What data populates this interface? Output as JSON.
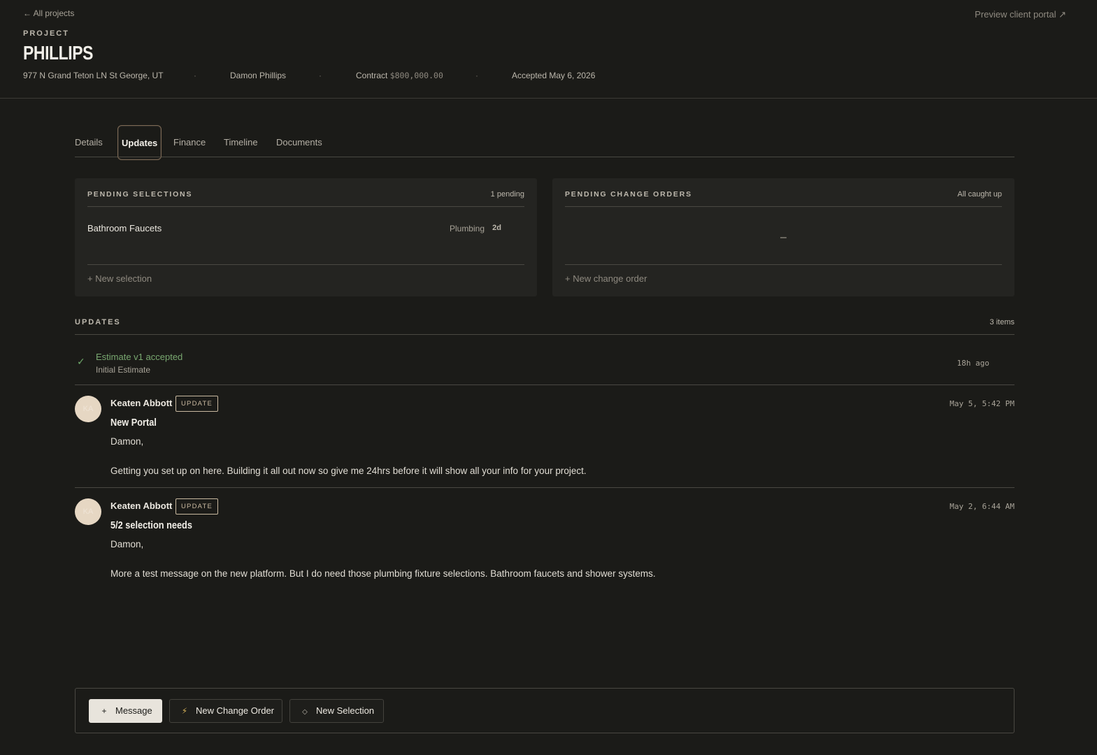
{
  "header": {
    "back_link": "← All projects",
    "preview_link": "Preview client portal ↗",
    "eyebrow": "PROJECT",
    "title": "PHILLIPS",
    "address": "977 N Grand Teton LN St George, UT",
    "client": "Damon Phillips",
    "contract_label": "Contract",
    "contract_value": "$800,000.00",
    "accepted": "Accepted May 6, 2026",
    "separator": "·"
  },
  "tabs": [
    {
      "label": "Details",
      "active": false
    },
    {
      "label": "Updates",
      "active": true
    },
    {
      "label": "Finance",
      "active": false
    },
    {
      "label": "Timeline",
      "active": false
    },
    {
      "label": "Documents",
      "active": false
    }
  ],
  "pending_selections": {
    "label": "PENDING SELECTIONS",
    "status": "1 pending",
    "items": [
      {
        "name": "Bathroom Faucets",
        "category": "Plumbing",
        "age": "2d"
      }
    ],
    "add_label": "+ New selection"
  },
  "pending_change_orders": {
    "label": "PENDING CHANGE ORDERS",
    "status": "All caught up",
    "empty": "–",
    "add_label": "+ New change order"
  },
  "updates": {
    "label": "UPDATES",
    "count": "3 items",
    "event": {
      "icon": "check-icon",
      "title": "Estimate v1 accepted",
      "subtitle": "Initial Estimate",
      "time": "18h ago",
      "accent": "#79a870"
    },
    "posts": [
      {
        "initials": "KA",
        "author": "Keaten Abbott",
        "badge": "UPDATE",
        "time": "May 5, 5:42 PM",
        "title": "New Portal",
        "greeting": "Damon,",
        "body": "Getting you set up on here. Building it all out now so give me 24hrs before it will show all your info for your project."
      },
      {
        "initials": "KA",
        "author": "Keaten Abbott",
        "badge": "UPDATE",
        "time": "May 2, 6:44 AM",
        "title": "5/2 selection needs",
        "greeting": "Damon,",
        "body": "More a test message on the new platform. But I do need those plumbing fixture selections. Bathroom faucets and shower systems."
      }
    ]
  },
  "composer": {
    "message": {
      "icon": "plus-icon",
      "label": "Message"
    },
    "change_order": {
      "icon": "bolt-icon",
      "label": "New Change Order"
    },
    "selection": {
      "icon": "diamond-icon",
      "label": "New Selection"
    }
  },
  "colors": {
    "background": "#1b1b18",
    "card": "#242421",
    "success": "#79a870",
    "badge": "#c9b9a0",
    "avatar": "#e6d7c3",
    "bolt": "#d6b258"
  }
}
